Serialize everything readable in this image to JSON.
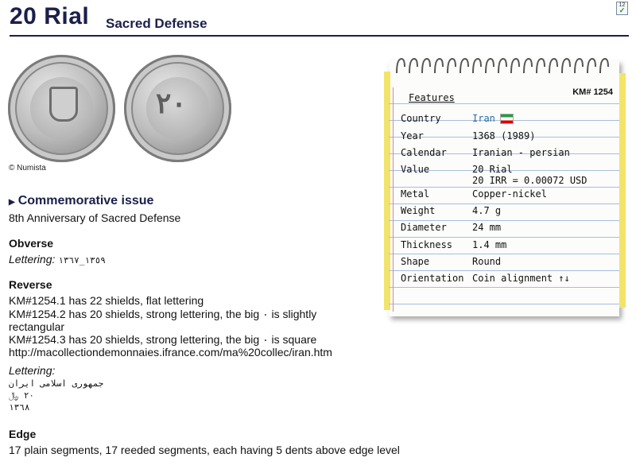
{
  "header": {
    "title": "20 Rial",
    "subtitle": "Sacred Defense"
  },
  "images": {
    "obverse_alt": "obverse coin image",
    "reverse_alt": "reverse coin image",
    "copyright": "© Numista"
  },
  "commemorative": {
    "heading": "Commemorative issue",
    "text": "8th Anniversary of Sacred Defense"
  },
  "obverse": {
    "heading": "Obverse",
    "lettering_label": "Lettering:",
    "lettering_value": "١٣٥٩_١٣٦٧"
  },
  "reverse": {
    "heading": "Reverse",
    "lines": [
      "KM#1254.1 has 22 shields, flat lettering",
      "KM#1254.2 has 20 shields, strong lettering, the big ٠ is slightly",
      "rectangular",
      "KM#1254.3 has 20 shields, strong lettering, the big ٠ is square",
      "http://macollectiondemonnaies.ifrance.com/ma%20collec/iran.htm"
    ],
    "lettering_label": "Lettering:",
    "lettering_lines": [
      "جمهوری اسلامی ایران",
      "٢٠ ﷼",
      "١٣٦٨"
    ]
  },
  "edge": {
    "heading": "Edge",
    "text": "17 plain segments, 17 reeded segments, each having 5 dents above edge level"
  },
  "features": {
    "heading": "Features",
    "km": "KM# 1254",
    "rows": [
      {
        "label": "Country",
        "value": "Iran",
        "value2": ""
      },
      {
        "label": "Year",
        "value": "1368 (1989)",
        "value2": ""
      },
      {
        "label": "Calendar",
        "value": "Iranian - persian",
        "value2": ""
      },
      {
        "label": "Value",
        "value": "20 Rial",
        "value2": "20 IRR = 0.00072 USD"
      },
      {
        "label": "Metal",
        "value": "Copper-nickel",
        "value2": ""
      },
      {
        "label": "Weight",
        "value": "4.7 g",
        "value2": ""
      },
      {
        "label": "Diameter",
        "value": "24 mm",
        "value2": ""
      },
      {
        "label": "Thickness",
        "value": "1.4 mm",
        "value2": ""
      },
      {
        "label": "Shape",
        "value": "Round",
        "value2": ""
      },
      {
        "label": "Orientation",
        "value": "Coin alignment ↑↓",
        "value2": ""
      }
    ]
  },
  "colors": {
    "heading": "#1b1f4a",
    "link": "#2a6fa8"
  },
  "icons": {
    "external": "checklist-icon",
    "flag": "iran-flag-icon"
  }
}
